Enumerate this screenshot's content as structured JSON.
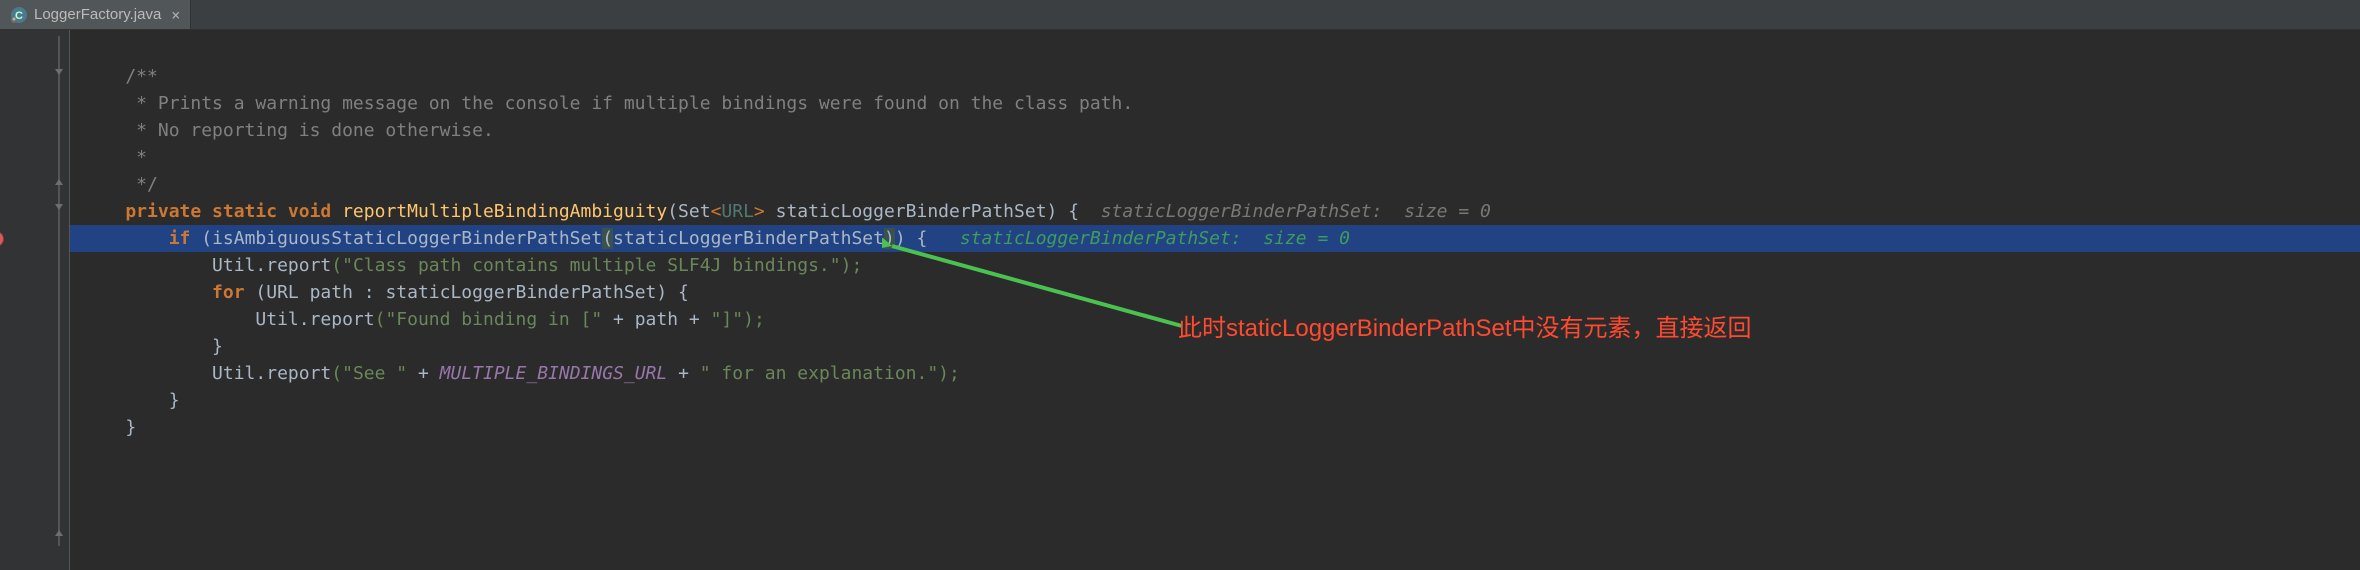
{
  "tab": {
    "filename": "LoggerFactory.java",
    "close_glyph": "×"
  },
  "code": {
    "c1": "    /**",
    "c2": "     * Prints a warning message on the console if multiple bindings were found on the class path.",
    "c3": "     * No reporting is done otherwise.",
    "c4": "     *",
    "c5": "     */",
    "sig_private": "    private ",
    "sig_static": "static ",
    "sig_void": "void ",
    "sig_name": "reportMultipleBindingAmbiguity",
    "sig_open": "(",
    "sig_set": "Set",
    "sig_lt": "<",
    "sig_url": "URL",
    "sig_gt": ">",
    "sig_param": " staticLoggerBinderPathSet",
    "sig_close_brace": ") {",
    "sig_inlay": "  staticLoggerBinderPathSet:  size = 0",
    "if_kw": "        if ",
    "if_open": "(",
    "if_call": "isAmbiguousStaticLoggerBinderPathSet",
    "if_popen": "(",
    "if_arg": "staticLoggerBinderPathSet",
    "if_pclose": ")",
    "if_close": ") {",
    "if_inlay": "   staticLoggerBinderPathSet:  size = 0",
    "u1_pre": "            Util.",
    "u1_m": "report",
    "u1_s": "(\"Class path contains multiple SLF4J bindings.\");",
    "for_kw": "            for ",
    "for_open": "(",
    "for_type": "URL",
    "for_var": " path : staticLoggerBinderPathSet) {",
    "u2_pre": "                Util.",
    "u2_m": "report",
    "u2_s1": "(\"Found binding in [\" ",
    "u2_plus1": "+ ",
    "u2_var": "path ",
    "u2_plus2": "+ ",
    "u2_s2": "\"]\");",
    "rb1": "            }",
    "u3_pre": "            Util.",
    "u3_m": "report",
    "u3_s1": "(\"See \" ",
    "u3_plus1": "+ ",
    "u3_const": "MULTIPLE_BINDINGS_URL",
    "u3_plus2": " + ",
    "u3_s2": "\" for an explanation.\");",
    "rb2": "        }",
    "rb3": "    }"
  },
  "annotation": {
    "text": "此时staticLoggerBinderPathSet中没有元素，直接返回"
  }
}
